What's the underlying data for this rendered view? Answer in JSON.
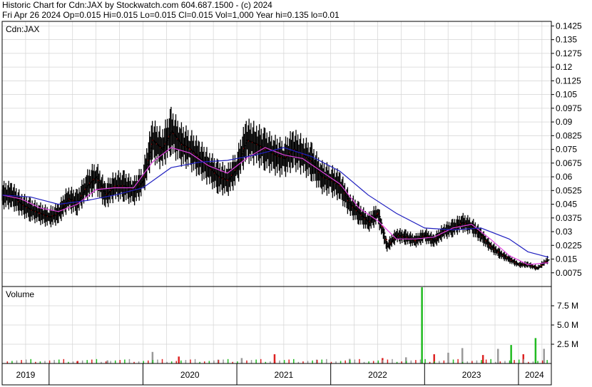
{
  "header": {
    "line1": "Historic Chart for Cdn:JAX by Stockwatch.com 604.687.1500 - (c) 2024",
    "line2": "Fri Apr 26 2024   Op=0.015  Hi=0.015  Lo=0.015  Cl=0.015  Vol=1,000  Year hi=0.135  lo=0.01"
  },
  "price_panel": {
    "symbol_label": "Cdn:JAX"
  },
  "volume_panel": {
    "label": "Volume"
  },
  "colors": {
    "background": "#ffffff",
    "grid": "#d4d4d4",
    "price_bar": "#000000",
    "down_mark": "#e00000",
    "ma_short": "#e040e0",
    "ma_long": "#2020c0",
    "vol_up": "#22bb22",
    "vol_down": "#dd2222",
    "vol_flat": "#999999"
  },
  "chart_data": [
    {
      "type": "line",
      "title": "Historic Chart for Cdn:JAX",
      "ylabel": "",
      "ylim": [
        0.0,
        0.145
      ],
      "y_ticks": [
        0.1425,
        0.135,
        0.1275,
        0.12,
        0.1125,
        0.105,
        0.0975,
        0.09,
        0.0825,
        0.075,
        0.0675,
        0.06,
        0.0525,
        0.045,
        0.0375,
        0.03,
        0.0225,
        0.015,
        0.0075
      ],
      "y_tick_labels": [
        "0.1425",
        "0.135",
        "0.1275",
        "0.12",
        "0.1125",
        "0.105",
        "0.0975",
        "0.09",
        "0.0825",
        "0.075",
        "0.0675",
        "0.06",
        "0.0525",
        "0.045",
        "0.0375",
        "0.03",
        "0.0225",
        "0.015",
        "0.0075"
      ],
      "x_axis_years": [
        "2019",
        "2020",
        "2021",
        "2022",
        "2023",
        "2024"
      ],
      "grid": true,
      "series": [
        {
          "x": [
            2018.5,
            2018.6,
            2018.7,
            2018.8,
            2018.9,
            2019.0,
            2019.1,
            2019.2,
            2019.3,
            2019.4,
            2019.5,
            2019.6,
            2019.7,
            2019.8,
            2019.9,
            2020.0,
            2020.1,
            2020.2,
            2020.3,
            2020.4,
            2020.5,
            2020.6,
            2020.7,
            2020.8,
            2020.9,
            2021.0,
            2021.1,
            2021.2,
            2021.3,
            2021.4,
            2021.5,
            2021.6,
            2021.7,
            2021.8,
            2021.9,
            2022.0,
            2022.1,
            2022.2,
            2022.3,
            2022.4,
            2022.5,
            2022.6,
            2022.7,
            2022.8,
            2022.9,
            2023.0,
            2023.1,
            2023.2,
            2023.3,
            2023.4,
            2023.5,
            2023.6,
            2023.7,
            2023.8,
            2023.9,
            2024.0,
            2024.1,
            2024.2,
            2024.32
          ],
          "values": [
            0.05,
            0.05,
            0.045,
            0.042,
            0.04,
            0.038,
            0.04,
            0.048,
            0.046,
            0.055,
            0.06,
            0.05,
            0.055,
            0.055,
            0.052,
            0.058,
            0.08,
            0.075,
            0.085,
            0.078,
            0.075,
            0.07,
            0.065,
            0.06,
            0.058,
            0.065,
            0.08,
            0.078,
            0.075,
            0.072,
            0.07,
            0.075,
            0.072,
            0.068,
            0.06,
            0.058,
            0.055,
            0.045,
            0.04,
            0.035,
            0.04,
            0.022,
            0.028,
            0.027,
            0.025,
            0.028,
            0.025,
            0.03,
            0.032,
            0.035,
            0.033,
            0.028,
            0.022,
            0.018,
            0.015,
            0.012,
            0.012,
            0.01,
            0.015
          ]
        },
        {
          "x": [
            2018.5,
            2018.7,
            2018.9,
            2019.1,
            2019.3,
            2019.5,
            2019.7,
            2019.9,
            2020.1,
            2020.3,
            2020.5,
            2020.7,
            2020.9,
            2021.1,
            2021.3,
            2021.5,
            2021.7,
            2021.9,
            2022.1,
            2022.3,
            2022.5,
            2022.7,
            2022.9,
            2023.1,
            2023.3,
            2023.5,
            2023.7,
            2023.9,
            2024.1,
            2024.32
          ],
          "values": [
            0.05,
            0.048,
            0.043,
            0.041,
            0.045,
            0.053,
            0.054,
            0.054,
            0.068,
            0.076,
            0.073,
            0.066,
            0.062,
            0.07,
            0.076,
            0.072,
            0.07,
            0.063,
            0.056,
            0.043,
            0.036,
            0.026,
            0.026,
            0.027,
            0.032,
            0.034,
            0.026,
            0.017,
            0.012,
            0.013
          ]
        },
        {
          "x": [
            2018.5,
            2018.8,
            2019.1,
            2019.4,
            2019.7,
            2020.0,
            2020.3,
            2020.6,
            2020.9,
            2021.2,
            2021.5,
            2021.8,
            2022.1,
            2022.4,
            2022.7,
            2023.0,
            2023.3,
            2023.6,
            2023.9,
            2024.1,
            2024.32
          ],
          "values": [
            0.05,
            0.049,
            0.045,
            0.047,
            0.05,
            0.054,
            0.065,
            0.068,
            0.069,
            0.072,
            0.076,
            0.071,
            0.063,
            0.05,
            0.04,
            0.032,
            0.031,
            0.032,
            0.026,
            0.019,
            0.016
          ]
        }
      ]
    },
    {
      "type": "bar",
      "title": "Volume",
      "ylim": [
        0,
        10000000
      ],
      "y_ticks": [
        7500000,
        5000000,
        2500000
      ],
      "y_tick_labels": [
        "7.5 M",
        "5.0 M",
        "2.5 M"
      ],
      "x": [
        2019.3,
        2019.62,
        2020.1,
        2020.38,
        2020.8,
        2021.05,
        2021.4,
        2021.85,
        2022.2,
        2022.55,
        2022.8,
        2022.97,
        2023.1,
        2023.25,
        2023.4,
        2023.62,
        2023.78,
        2023.92,
        2024.05,
        2024.18,
        2024.27
      ],
      "values": [
        300000,
        400000,
        1500000,
        900000,
        500000,
        700000,
        1200000,
        500000,
        600000,
        700000,
        800000,
        9900000,
        1200000,
        1400000,
        2000000,
        1100000,
        1900000,
        2400000,
        1200000,
        3300000,
        1900000
      ]
    }
  ]
}
